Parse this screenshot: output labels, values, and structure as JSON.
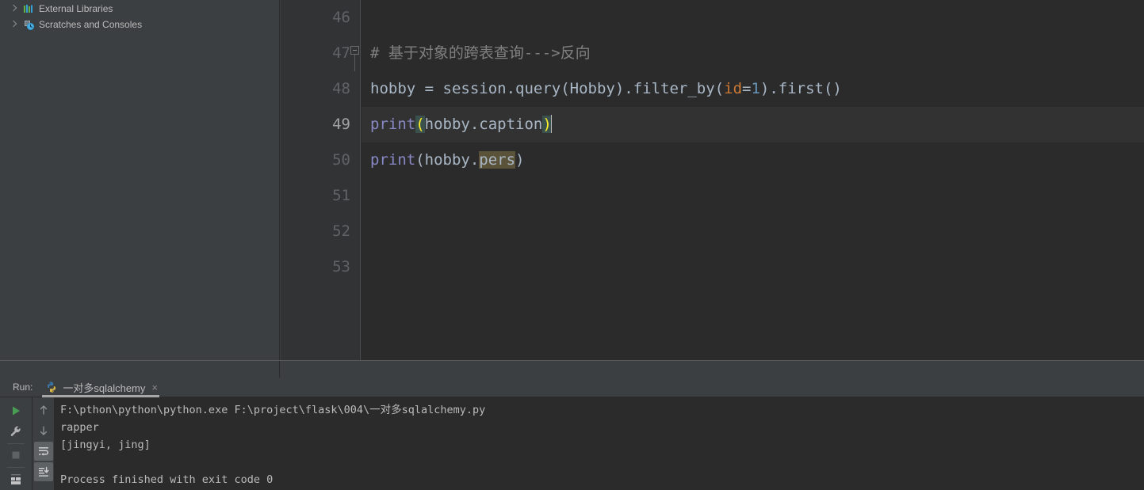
{
  "sidebar": {
    "items": [
      {
        "label": "External Libraries",
        "icon": "library-bars-icon",
        "expanded": false
      },
      {
        "label": "Scratches and Consoles",
        "icon": "scratches-clock-icon",
        "expanded": false
      }
    ]
  },
  "editor": {
    "gutter_lines": [
      "46",
      "47",
      "48",
      "49",
      "50",
      "51",
      "52",
      "53"
    ],
    "current_line": "49",
    "lines": [
      {
        "num": "46",
        "segments": []
      },
      {
        "num": "47",
        "fold": true,
        "segments": [
          {
            "t": "# 基于对象的跨表查询--->反向",
            "c": "comment"
          }
        ]
      },
      {
        "num": "48",
        "segments": [
          {
            "t": "hobby = session.query(Hobby).filter_by(",
            "c": "plain"
          },
          {
            "t": "id",
            "c": "kw"
          },
          {
            "t": "=",
            "c": "plain"
          },
          {
            "t": "1",
            "c": "num"
          },
          {
            "t": ").first()",
            "c": "plain"
          }
        ]
      },
      {
        "num": "49",
        "current": true,
        "caret": true,
        "segments": [
          {
            "t": "print",
            "c": "fn"
          },
          {
            "t": "(",
            "c": "paren-match"
          },
          {
            "t": "hobby.caption",
            "c": "plain"
          },
          {
            "t": ")",
            "c": "paren-match"
          }
        ]
      },
      {
        "num": "50",
        "segments": [
          {
            "t": "print",
            "c": "fn"
          },
          {
            "t": "(hobby.",
            "c": "plain"
          },
          {
            "t": "pers",
            "c": "unresolved"
          },
          {
            "t": ")",
            "c": "plain"
          }
        ]
      },
      {
        "num": "51",
        "segments": []
      },
      {
        "num": "52",
        "segments": []
      },
      {
        "num": "53",
        "segments": []
      }
    ]
  },
  "run_panel": {
    "label": "Run:",
    "tab": {
      "title": "一对多sqlalchemy",
      "icon": "python-icon",
      "close": "×"
    },
    "toolbar_left": [
      {
        "name": "rerun-button",
        "icon": "play-icon"
      },
      {
        "name": "settings-button",
        "icon": "wrench-icon"
      },
      {
        "name": "stop-button",
        "icon": "stop-square-icon"
      },
      {
        "name": "layout-button",
        "icon": "layout-grid-icon"
      }
    ],
    "toolbar_right": [
      {
        "name": "up-button",
        "icon": "arrow-up-icon",
        "active": false
      },
      {
        "name": "down-button",
        "icon": "arrow-down-icon",
        "active": false
      },
      {
        "name": "soft-wrap-button",
        "icon": "soft-wrap-icon",
        "active": true
      },
      {
        "name": "scroll-to-end-button",
        "icon": "scroll-to-end-icon",
        "active": true
      }
    ],
    "console_lines": [
      "F:\\pthon\\python\\python.exe F:\\project\\flask\\004\\一对多sqlalchemy.py",
      "rapper",
      "[jingyi, jing]",
      "",
      "Process finished with exit code 0"
    ]
  },
  "colors": {
    "editor_bg": "#2b2b2b",
    "gutter_bg": "#313335",
    "panel_bg": "#3c3f41",
    "current_line_bg": "#323232",
    "text": "#a9b7c6",
    "comment": "#808080",
    "keyword": "#cc7832",
    "number": "#6897bb",
    "function": "#8888c6",
    "paren_match_fg": "#ffef28",
    "paren_match_bg": "#3b514d",
    "unresolved_bg": "#5b5339",
    "run_green": "#499c54"
  }
}
